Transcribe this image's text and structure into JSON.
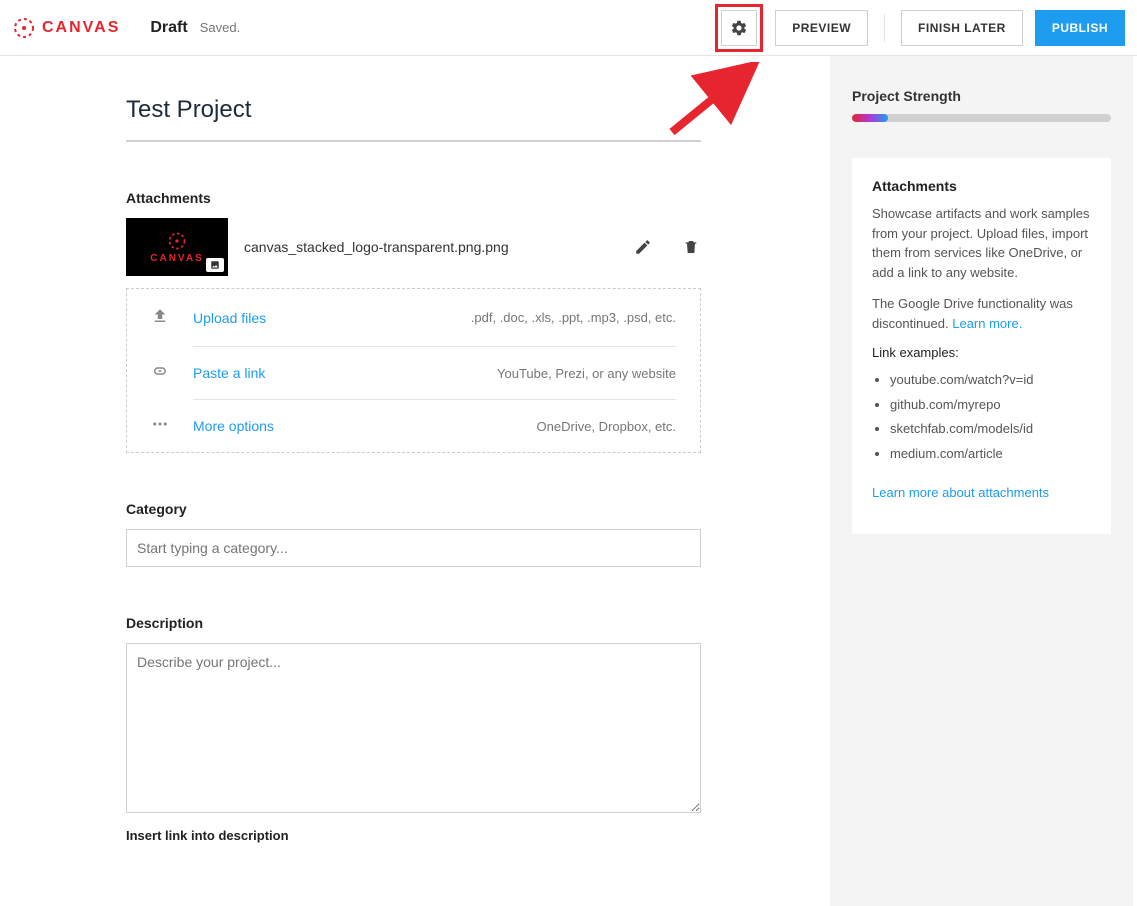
{
  "header": {
    "brand": "CANVAS",
    "status": "Draft",
    "saved": "Saved.",
    "buttons": {
      "preview": "PREVIEW",
      "finish_later": "FINISH LATER",
      "publish": "PUBLISH"
    }
  },
  "main": {
    "project_title": "Test Project",
    "attachments_label": "Attachments",
    "attachment": {
      "filename": "canvas_stacked_logo-transparent.png.png",
      "thumb_text": "CANVAS"
    },
    "upload": {
      "upload_files": "Upload files",
      "upload_files_hint": ".pdf, .doc, .xls, .ppt, .mp3, .psd, etc.",
      "paste_link": "Paste a link",
      "paste_link_hint": "YouTube, Prezi, or any website",
      "more_options": "More options",
      "more_options_hint": "OneDrive, Dropbox, etc."
    },
    "category_label": "Category",
    "category_placeholder": "Start typing a category...",
    "description_label": "Description",
    "description_placeholder": "Describe your project...",
    "insert_link": "Insert link into description"
  },
  "sidebar": {
    "strength_title": "Project Strength",
    "strength_percent": 14,
    "card": {
      "title": "Attachments",
      "p1": "Showcase artifacts and work samples from your project. Upload files, import them from services like OneDrive, or add a link to any website.",
      "p2a": "The Google Drive functionality was discontinued. ",
      "p2_link": "Learn more.",
      "examples_label": "Link examples:",
      "examples": [
        "youtube.com/watch?v=id",
        "github.com/myrepo",
        "sketchfab.com/models/id",
        "medium.com/article"
      ],
      "learn_more": "Learn more about attachments"
    }
  }
}
